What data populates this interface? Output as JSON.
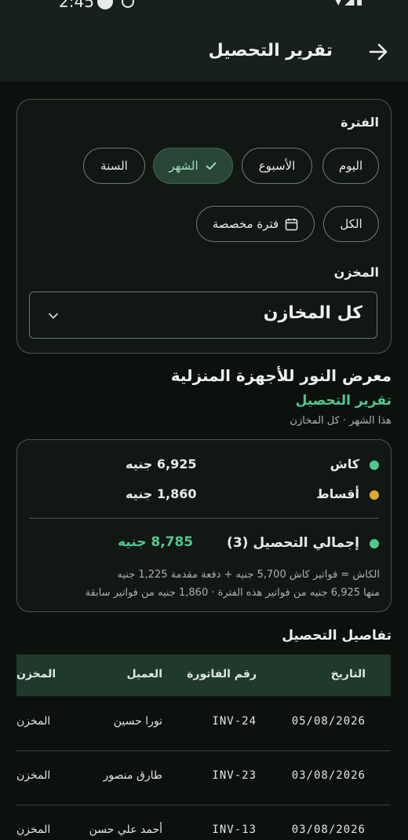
{
  "status_bar": {
    "time": "2:45",
    "right_icons": "▼◢▮"
  },
  "app_bar": {
    "title": "تقرير التحصيل"
  },
  "filters": {
    "period_label": "الفترة",
    "period_options": [
      "اليوم",
      "الأسبوع",
      "الشهر",
      "السنة",
      "الكل",
      "فترة مخصصة"
    ],
    "selected_period": "الشهر",
    "warehouse_label": "المخزن",
    "warehouse_value": "كل المخازن"
  },
  "report": {
    "business_name": "معرض النور للأجهزة المنزلية",
    "title": "تقرير التحصيل",
    "meta": "هذا الشهر · كل المخازن"
  },
  "summary": {
    "cash_label": "كاش",
    "cash_amount": "6,925 جنيه",
    "installments_label": "أقساط",
    "installments_amount": "1,860 جنيه",
    "total_label": "إجمالي التحصيل (3)",
    "total_amount": "8,785 جنيه",
    "note1": "الكاش = فواتير كاش 5,700 جنيه + دفعة مقدمة 1,225 جنيه",
    "note2": "منها 6,925 جنيه من فواتير هذه الفترة · 1,860 جنيه من فواتير سابقة",
    "colors": {
      "cash": "#4ec98b",
      "installments": "#e0a92c",
      "total": "#4ec98b"
    }
  },
  "details": {
    "title": "تفاصيل التحصيل",
    "columns": {
      "date": "التاريخ",
      "invoice": "رقم الفاتورة",
      "customer": "العميل",
      "warehouse": "المخزن"
    },
    "rows": [
      {
        "date": "05/08/2026",
        "invoice": "INV-24",
        "customer": "نورا حسين",
        "warehouse": "المخزن"
      },
      {
        "date": "03/08/2026",
        "invoice": "INV-23",
        "customer": "طارق منصور",
        "warehouse": "المخزن"
      },
      {
        "date": "03/08/2026",
        "invoice": "INV-13",
        "customer": "أحمد علي حسن",
        "warehouse": "المخزن"
      }
    ]
  }
}
